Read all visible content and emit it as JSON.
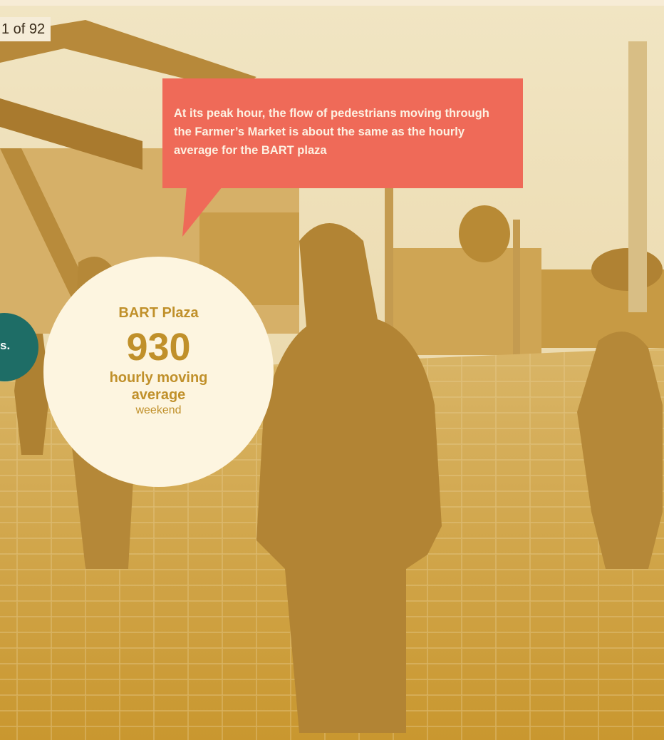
{
  "pagination": {
    "label": "1 of 92"
  },
  "callout": {
    "text": "At its peak hour, the flow of pedestrians moving through the Farmer’s Market is about the same as the hourly average for the BART plaza"
  },
  "stat": {
    "title": "BART Plaza",
    "value": "930",
    "label": "hourly moving average",
    "sublabel": "weekend"
  },
  "side_badge": {
    "text": "s."
  },
  "colors": {
    "photo_tint": "#c9972f",
    "callout_bg": "#ef6a58",
    "circle_bg": "#fdf5e0",
    "accent_text": "#c0902a",
    "teal": "#1e6d66"
  }
}
